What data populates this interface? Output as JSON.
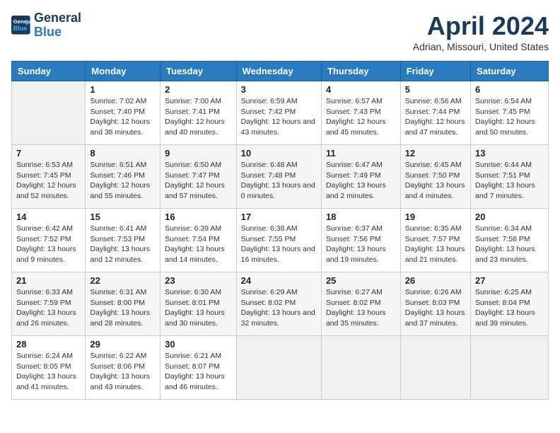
{
  "header": {
    "logo_line1": "General",
    "logo_line2": "Blue",
    "month": "April 2024",
    "location": "Adrian, Missouri, United States"
  },
  "weekdays": [
    "Sunday",
    "Monday",
    "Tuesday",
    "Wednesday",
    "Thursday",
    "Friday",
    "Saturday"
  ],
  "weeks": [
    [
      {
        "day": "",
        "empty": true
      },
      {
        "day": "1",
        "sunrise": "7:02 AM",
        "sunset": "7:40 PM",
        "daylight": "12 hours and 38 minutes."
      },
      {
        "day": "2",
        "sunrise": "7:00 AM",
        "sunset": "7:41 PM",
        "daylight": "12 hours and 40 minutes."
      },
      {
        "day": "3",
        "sunrise": "6:59 AM",
        "sunset": "7:42 PM",
        "daylight": "12 hours and 43 minutes."
      },
      {
        "day": "4",
        "sunrise": "6:57 AM",
        "sunset": "7:43 PM",
        "daylight": "12 hours and 45 minutes."
      },
      {
        "day": "5",
        "sunrise": "6:56 AM",
        "sunset": "7:44 PM",
        "daylight": "12 hours and 47 minutes."
      },
      {
        "day": "6",
        "sunrise": "6:54 AM",
        "sunset": "7:45 PM",
        "daylight": "12 hours and 50 minutes."
      }
    ],
    [
      {
        "day": "7",
        "sunrise": "6:53 AM",
        "sunset": "7:45 PM",
        "daylight": "12 hours and 52 minutes."
      },
      {
        "day": "8",
        "sunrise": "6:51 AM",
        "sunset": "7:46 PM",
        "daylight": "12 hours and 55 minutes."
      },
      {
        "day": "9",
        "sunrise": "6:50 AM",
        "sunset": "7:47 PM",
        "daylight": "12 hours and 57 minutes."
      },
      {
        "day": "10",
        "sunrise": "6:48 AM",
        "sunset": "7:48 PM",
        "daylight": "13 hours and 0 minutes."
      },
      {
        "day": "11",
        "sunrise": "6:47 AM",
        "sunset": "7:49 PM",
        "daylight": "13 hours and 2 minutes."
      },
      {
        "day": "12",
        "sunrise": "6:45 AM",
        "sunset": "7:50 PM",
        "daylight": "13 hours and 4 minutes."
      },
      {
        "day": "13",
        "sunrise": "6:44 AM",
        "sunset": "7:51 PM",
        "daylight": "13 hours and 7 minutes."
      }
    ],
    [
      {
        "day": "14",
        "sunrise": "6:42 AM",
        "sunset": "7:52 PM",
        "daylight": "13 hours and 9 minutes."
      },
      {
        "day": "15",
        "sunrise": "6:41 AM",
        "sunset": "7:53 PM",
        "daylight": "13 hours and 12 minutes."
      },
      {
        "day": "16",
        "sunrise": "6:39 AM",
        "sunset": "7:54 PM",
        "daylight": "13 hours and 14 minutes."
      },
      {
        "day": "17",
        "sunrise": "6:38 AM",
        "sunset": "7:55 PM",
        "daylight": "13 hours and 16 minutes."
      },
      {
        "day": "18",
        "sunrise": "6:37 AM",
        "sunset": "7:56 PM",
        "daylight": "13 hours and 19 minutes."
      },
      {
        "day": "19",
        "sunrise": "6:35 AM",
        "sunset": "7:57 PM",
        "daylight": "13 hours and 21 minutes."
      },
      {
        "day": "20",
        "sunrise": "6:34 AM",
        "sunset": "7:58 PM",
        "daylight": "13 hours and 23 minutes."
      }
    ],
    [
      {
        "day": "21",
        "sunrise": "6:33 AM",
        "sunset": "7:59 PM",
        "daylight": "13 hours and 26 minutes."
      },
      {
        "day": "22",
        "sunrise": "6:31 AM",
        "sunset": "8:00 PM",
        "daylight": "13 hours and 28 minutes."
      },
      {
        "day": "23",
        "sunrise": "6:30 AM",
        "sunset": "8:01 PM",
        "daylight": "13 hours and 30 minutes."
      },
      {
        "day": "24",
        "sunrise": "6:29 AM",
        "sunset": "8:02 PM",
        "daylight": "13 hours and 32 minutes."
      },
      {
        "day": "25",
        "sunrise": "6:27 AM",
        "sunset": "8:02 PM",
        "daylight": "13 hours and 35 minutes."
      },
      {
        "day": "26",
        "sunrise": "6:26 AM",
        "sunset": "8:03 PM",
        "daylight": "13 hours and 37 minutes."
      },
      {
        "day": "27",
        "sunrise": "6:25 AM",
        "sunset": "8:04 PM",
        "daylight": "13 hours and 39 minutes."
      }
    ],
    [
      {
        "day": "28",
        "sunrise": "6:24 AM",
        "sunset": "8:05 PM",
        "daylight": "13 hours and 41 minutes."
      },
      {
        "day": "29",
        "sunrise": "6:22 AM",
        "sunset": "8:06 PM",
        "daylight": "13 hours and 43 minutes."
      },
      {
        "day": "30",
        "sunrise": "6:21 AM",
        "sunset": "8:07 PM",
        "daylight": "13 hours and 46 minutes."
      },
      {
        "day": "",
        "empty": true
      },
      {
        "day": "",
        "empty": true
      },
      {
        "day": "",
        "empty": true
      },
      {
        "day": "",
        "empty": true
      }
    ]
  ],
  "labels": {
    "sunrise": "Sunrise:",
    "sunset": "Sunset:",
    "daylight": "Daylight:"
  }
}
